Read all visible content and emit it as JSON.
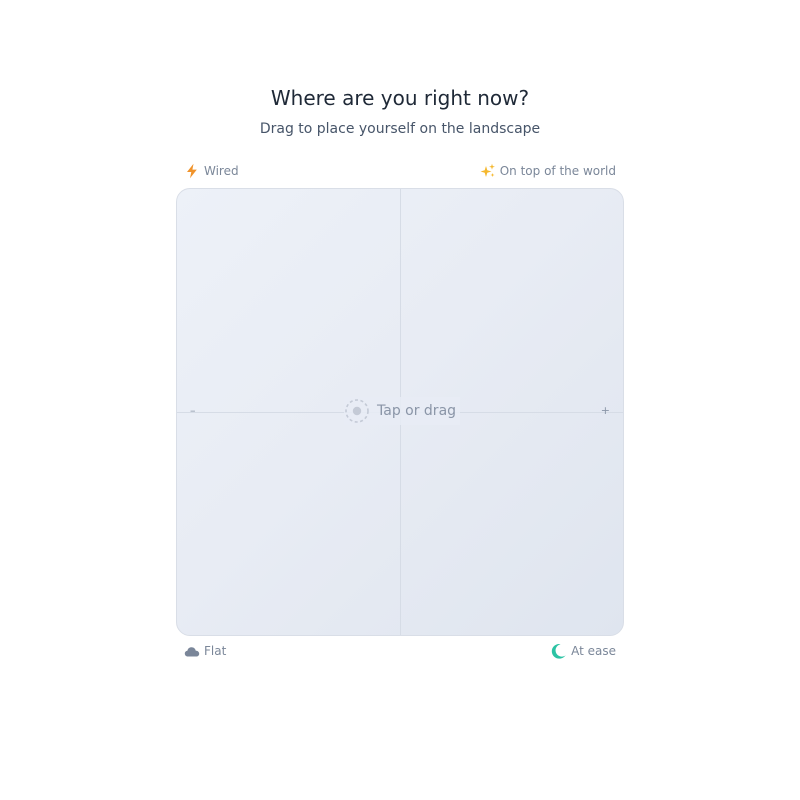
{
  "header": {
    "title": "Where are you right now?",
    "subtitle": "Drag to place yourself on the landscape"
  },
  "corners": {
    "top_left": {
      "label": "Wired",
      "icon": "lightning-icon",
      "color": "#f0932b"
    },
    "top_right": {
      "label": "On top of the world",
      "icon": "sparkles-icon",
      "color": "#f5b82e"
    },
    "bottom_left": {
      "label": "Flat",
      "icon": "cloud-icon",
      "color": "#7a8699"
    },
    "bottom_right": {
      "label": "At ease",
      "icon": "moon-icon",
      "color": "#2cc3a4"
    }
  },
  "pad": {
    "hint": "Tap or drag",
    "minus_label": "–",
    "plus_label": "+"
  }
}
